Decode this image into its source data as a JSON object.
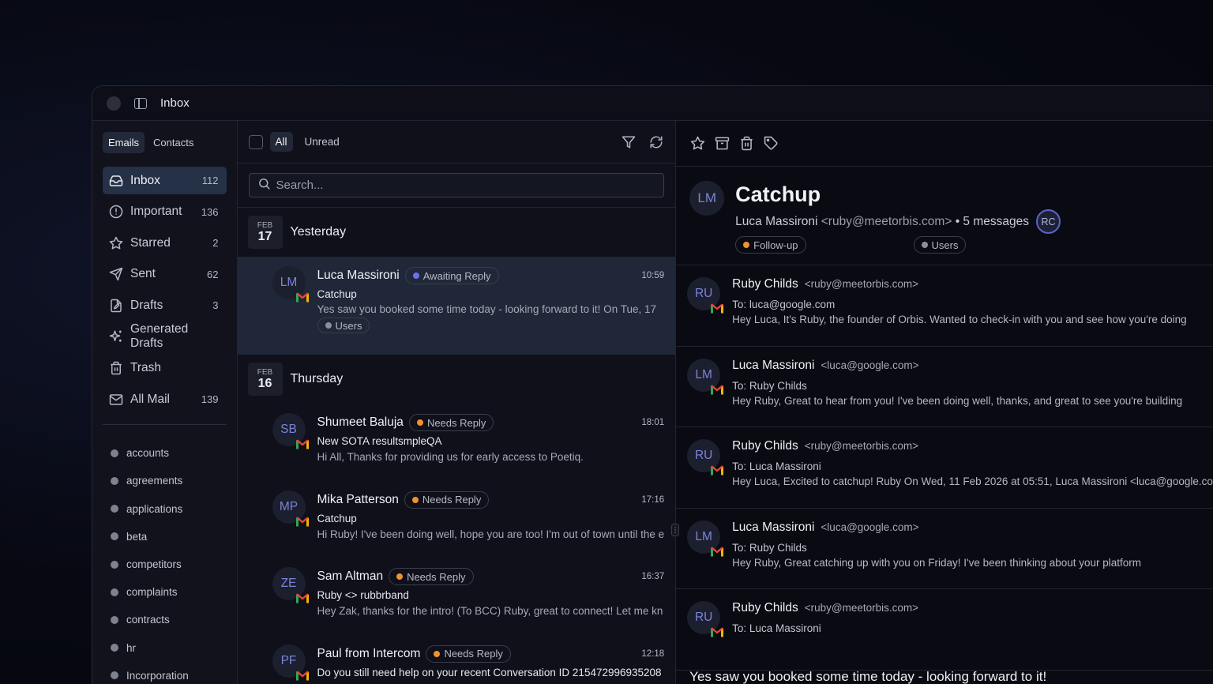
{
  "window": {
    "title": "Inbox"
  },
  "sidebar": {
    "tabs": [
      {
        "label": "Emails"
      },
      {
        "label": "Contacts"
      }
    ],
    "items": [
      {
        "label": "Inbox",
        "count": "112",
        "icon": "inbox-icon"
      },
      {
        "label": "Important",
        "count": "136",
        "icon": "alert-circle-icon"
      },
      {
        "label": "Starred",
        "count": "2",
        "icon": "star-icon"
      },
      {
        "label": "Sent",
        "count": "62",
        "icon": "send-icon"
      },
      {
        "label": "Drafts",
        "count": "3",
        "icon": "draft-icon"
      },
      {
        "label": "Generated Drafts",
        "count": "",
        "icon": "sparkle-icon"
      },
      {
        "label": "Trash",
        "count": "",
        "icon": "trash-icon"
      },
      {
        "label": "All Mail",
        "count": "139",
        "icon": "mail-icon"
      }
    ],
    "labels": [
      "accounts",
      "agreements",
      "applications",
      "beta",
      "competitors",
      "complaints",
      "contracts",
      "hr",
      "Incorporation"
    ]
  },
  "list": {
    "filters": [
      {
        "label": "All"
      },
      {
        "label": "Unread"
      }
    ],
    "search": {
      "placeholder": "Search..."
    },
    "groups": [
      {
        "month": "FEB",
        "day": "17",
        "label": "Yesterday",
        "emails": [
          {
            "initials": "LM",
            "from": "Luca Massironi",
            "status": "Awaiting Reply",
            "status_color": "#6b6ff0",
            "time": "10:59",
            "subject": "Catchup",
            "snippet": "Yes saw you booked some time today - looking forward to it! On Tue, 17",
            "tag": "Users"
          }
        ]
      },
      {
        "month": "FEB",
        "day": "16",
        "label": "Thursday",
        "emails": [
          {
            "initials": "SB",
            "from": "Shumeet Baluja",
            "status": "Needs Reply",
            "status_color": "#f0922e",
            "time": "18:01",
            "subject": "New SOTA resultsmpleQA",
            "snippet": "Hi All, Thanks for providing us for early access to Poetiq."
          },
          {
            "initials": "MP",
            "from": "Mika Patterson",
            "status": "Needs Reply",
            "status_color": "#f0922e",
            "time": "17:16",
            "subject": "Catchup",
            "snippet": "Hi Ruby! I've been doing well, hope you are too! I'm out of town until the e"
          },
          {
            "initials": "ZE",
            "from": "Sam Altman",
            "status": "Needs Reply",
            "status_color": "#f0922e",
            "time": "16:37",
            "subject": "Ruby <> rubbrband",
            "snippet": "Hey Zak, thanks for the intro! (To BCC) Ruby, great to connect! Let me kn"
          },
          {
            "initials": "PF",
            "from": "Paul from Intercom",
            "status": "Needs Reply",
            "status_color": "#f0922e",
            "time": "12:18",
            "subject": "Do you still need help on your recent Conversation ID 215472996935208",
            "snippet": ""
          }
        ]
      }
    ]
  },
  "thread": {
    "initials": "LM",
    "title": "Catchup",
    "from": "Luca Massironi",
    "from_addr": "<ruby@meetorbis.com>",
    "count_text": "• 5 messages",
    "participant": "RC",
    "tags": [
      {
        "label": "Follow-up",
        "color": "#f0922e"
      },
      {
        "label": "Users",
        "color": "#8a8f9c"
      }
    ],
    "messages": [
      {
        "initials": "RU",
        "from": "Ruby Childs",
        "addr": "<ruby@meetorbis.com>",
        "to": "To: luca@google.com",
        "preview": "Hey Luca, It's Ruby, the founder of Orbis. Wanted to check-in with you and see how you're doing"
      },
      {
        "initials": "LM",
        "from": "Luca Massironi",
        "addr": "<luca@google.com>",
        "to": "To: Ruby Childs",
        "preview": "Hey Ruby, Great to hear from you! I've been doing well, thanks, and great to see you're building"
      },
      {
        "initials": "RU",
        "from": "Ruby Childs",
        "addr": "<ruby@meetorbis.com>",
        "to": "To: Luca Massironi",
        "preview": "Hey Luca, Excited to catchup! Ruby On Wed, 11 Feb 2026 at 05:51, Luca Massironi <luca@google.com>"
      },
      {
        "initials": "LM",
        "from": "Luca Massironi",
        "addr": "<luca@google.com>",
        "to": "To: Ruby Childs",
        "preview": "Hey Ruby, Great catching up with you on Friday! I've been thinking about your platform"
      },
      {
        "initials": "RU",
        "from": "Ruby Childs",
        "addr": "<ruby@meetorbis.com>",
        "to": "To: Luca Massironi",
        "preview": ""
      }
    ],
    "body": "Yes saw you booked some time today - looking forward to it!"
  },
  "colors": {
    "accent": "#6b6ff0",
    "needs_reply": "#f0922e",
    "selected_row": "#1f2738",
    "active_nav": "#243146"
  }
}
